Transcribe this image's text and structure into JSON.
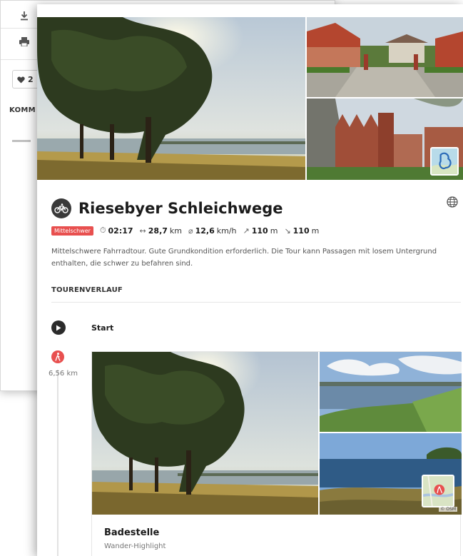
{
  "background_window": {
    "like_count": "2",
    "comments_heading": "KOMM"
  },
  "tour": {
    "title": "Riesebyer Schleichwege",
    "difficulty": "Mittelschwer",
    "duration": "02:17",
    "distance_value": "28,7",
    "distance_unit": "km",
    "speed_value": "12,6",
    "speed_unit": "km/h",
    "ascent_value": "110",
    "ascent_unit": "m",
    "descent_value": "110",
    "descent_unit": "m",
    "description": "Mittelschwere Fahrradtour. Gute Grundkondition erforderlich. Die Tour kann Passagen mit losem Untergrund enthalten, die schwer zu befahren sind."
  },
  "route": {
    "heading": "TOURENVERLAUF",
    "start_label": "Start",
    "waypoints": [
      {
        "distance": "6,56 km",
        "title": "Badestelle",
        "subtitle": "Wander-Highlight",
        "map_credit": "© OSM"
      }
    ]
  },
  "icons": {
    "download": "download-icon",
    "print": "print-icon",
    "heart": "heart-icon",
    "globe": "globe-icon",
    "bike": "bike-icon",
    "start": "play-icon",
    "hiker": "hiker-icon"
  },
  "colors": {
    "difficulty": "#e8504f",
    "waypoint": "#e8504f",
    "dark_icon": "#2b2b2b"
  }
}
